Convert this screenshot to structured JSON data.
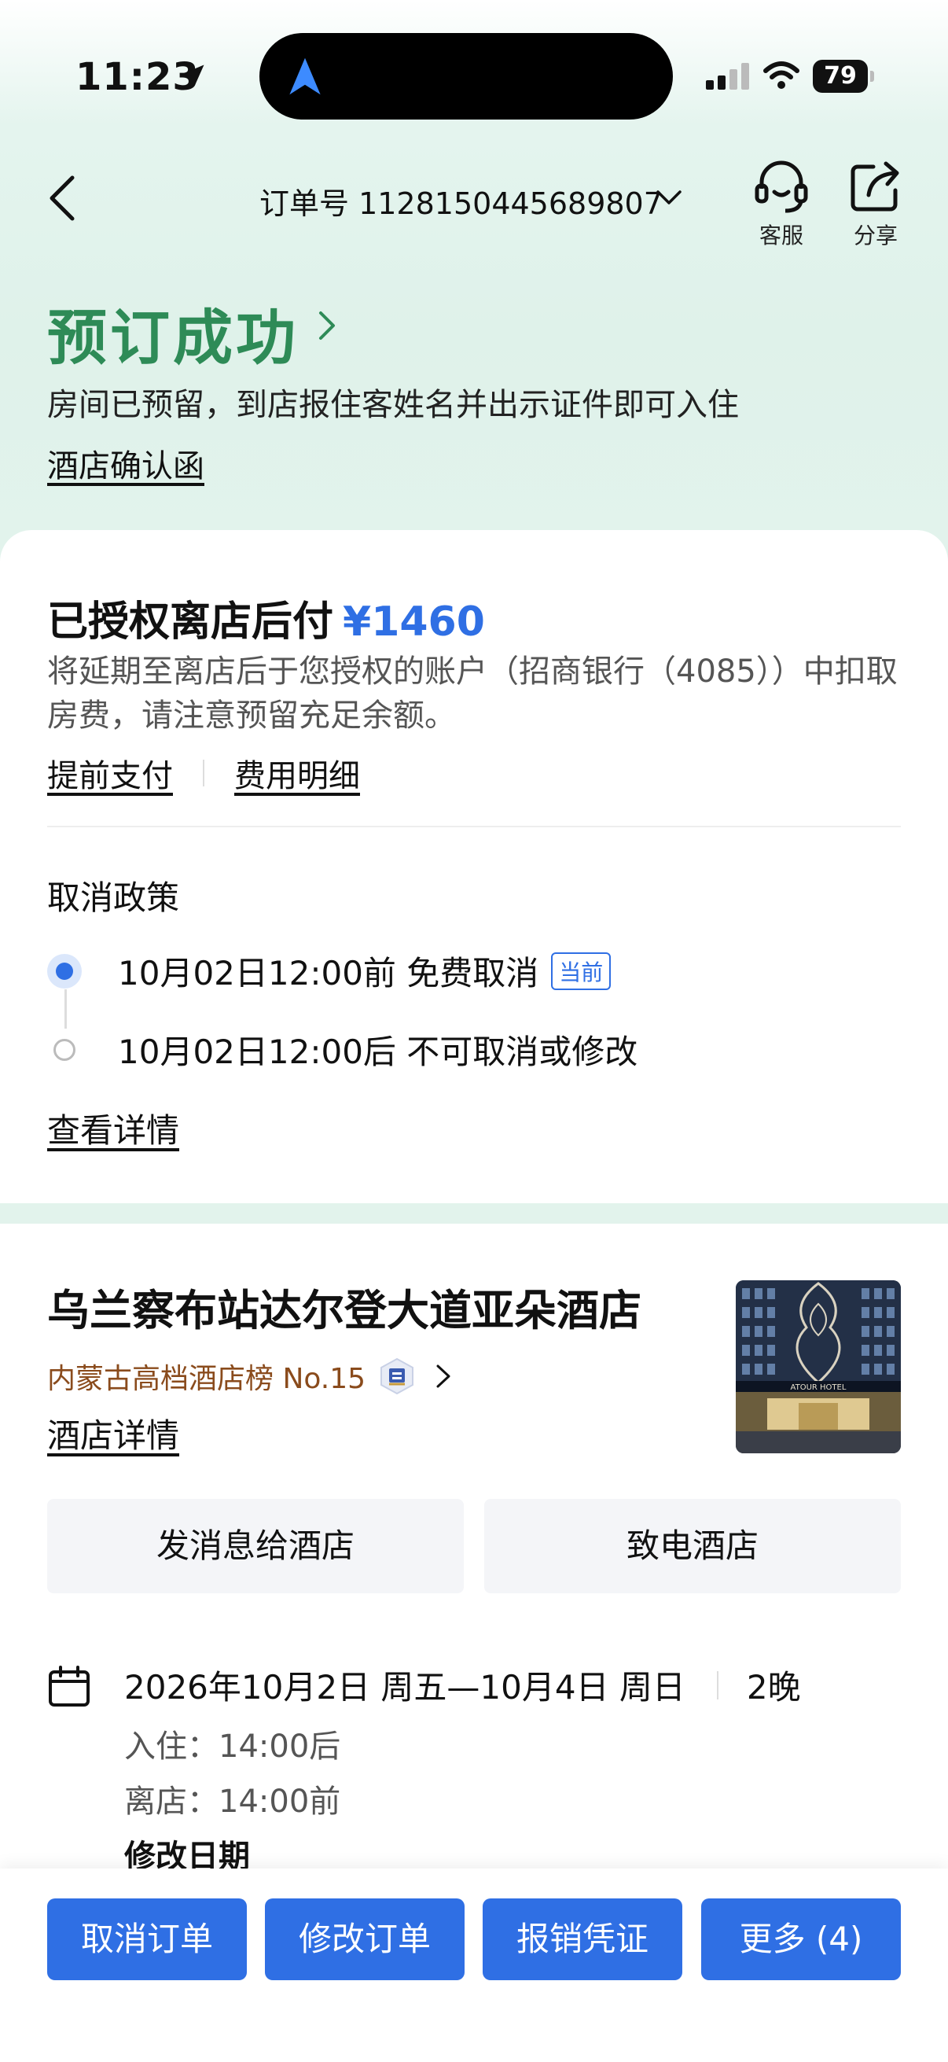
{
  "status_bar": {
    "time": "11:23",
    "battery": "79"
  },
  "nav": {
    "order_number": "订单号 1128150445689807",
    "customer_service_label": "客服",
    "share_label": "分享"
  },
  "header": {
    "title": "预订成功",
    "description": "房间已预留，到店报住客姓名并出示证件即可入住",
    "confirmation_link": "酒店确认函"
  },
  "payment": {
    "title": "已授权离店后付",
    "amount": "¥1460",
    "description": "将延期至离店后于您授权的账户（招商银行（4085））中扣取房费，请注意预留充足余额。",
    "prepay_link": "提前支付",
    "fee_detail_link": "费用明细"
  },
  "cancellation": {
    "title": "取消政策",
    "rules": [
      {
        "text": "10月02日12:00前 免费取消",
        "badge": "当前"
      },
      {
        "text": "10月02日12:00后 不可取消或修改"
      }
    ],
    "detail_link": "查看详情"
  },
  "hotel": {
    "name": "乌兰察布站达尔登大道亚朵酒店",
    "ranking": "内蒙古高档酒店榜 No.15",
    "detail_link": "酒店详情",
    "message_button": "发消息给酒店",
    "call_button": "致电酒店",
    "image_sign": "ATOUR HOTEL"
  },
  "stay": {
    "dates": "2026年10月2日 周五—10月4日 周日",
    "nights": "2晚",
    "checkin": "入住：14:00后",
    "checkout": "离店：14:00前",
    "modify_date": "修改日期"
  },
  "bottom_actions": {
    "cancel_order": "取消订单",
    "modify_order": "修改订单",
    "receipt": "报销凭证",
    "more": "更多 (4)"
  },
  "colors": {
    "accent_blue": "#2f6fe4",
    "success_green": "#2e8b57",
    "ranking_brown": "#8a4b1c"
  }
}
